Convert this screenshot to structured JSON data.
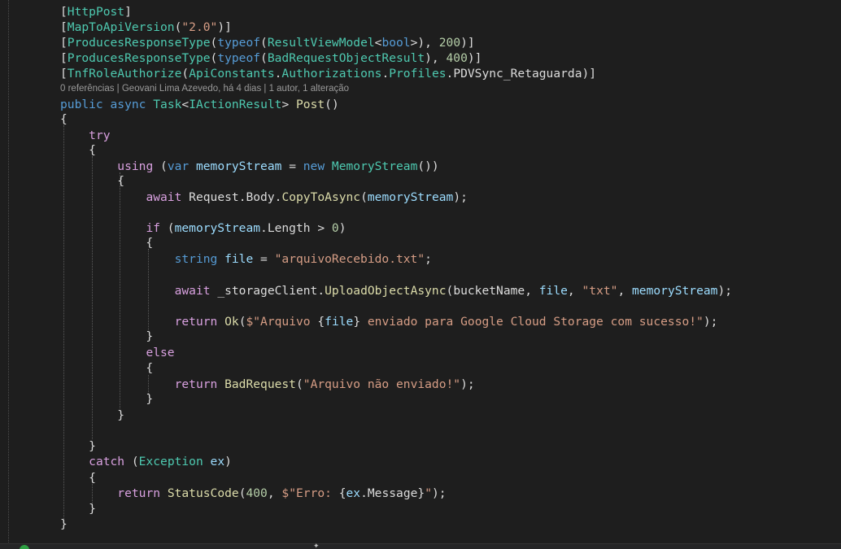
{
  "editor": {
    "codelens": "0 referências | Geovani Lima Azevedo, há 4 dias | 1 autor, 1 alteração",
    "lines": [
      [
        [
          "pn",
          "["
        ],
        [
          "ty",
          "HttpPost"
        ],
        [
          "pn",
          "]"
        ]
      ],
      [
        [
          "pn",
          "["
        ],
        [
          "ty",
          "MapToApiVersion"
        ],
        [
          "pn",
          "("
        ],
        [
          "str",
          "\"2.0\""
        ],
        [
          "pn",
          ")]"
        ]
      ],
      [
        [
          "pn",
          "["
        ],
        [
          "ty",
          "ProducesResponseType"
        ],
        [
          "pn",
          "("
        ],
        [
          "kw",
          "typeof"
        ],
        [
          "pn",
          "("
        ],
        [
          "ty",
          "ResultViewModel"
        ],
        [
          "pn",
          "<"
        ],
        [
          "kw",
          "bool"
        ],
        [
          "pn",
          ">), "
        ],
        [
          "num",
          "200"
        ],
        [
          "pn",
          ")]"
        ]
      ],
      [
        [
          "pn",
          "["
        ],
        [
          "ty",
          "ProducesResponseType"
        ],
        [
          "pn",
          "("
        ],
        [
          "kw",
          "typeof"
        ],
        [
          "pn",
          "("
        ],
        [
          "ty",
          "BadRequestObjectResult"
        ],
        [
          "pn",
          "), "
        ],
        [
          "num",
          "400"
        ],
        [
          "pn",
          ")]"
        ]
      ],
      [
        [
          "pn",
          "["
        ],
        [
          "ty",
          "TnfRoleAuthorize"
        ],
        [
          "pn",
          "("
        ],
        [
          "ty",
          "ApiConstants"
        ],
        [
          "pn",
          "."
        ],
        [
          "ty",
          "Authorizations"
        ],
        [
          "pn",
          "."
        ],
        [
          "ty",
          "Profiles"
        ],
        [
          "pn",
          "."
        ],
        [
          "ident",
          "PDVSync_Retaguarda"
        ],
        [
          "pn",
          ")]"
        ]
      ],
      [
        [
          "kw",
          "public"
        ],
        [
          "pn",
          " "
        ],
        [
          "kw",
          "async"
        ],
        [
          "pn",
          " "
        ],
        [
          "ty",
          "Task"
        ],
        [
          "pn",
          "<"
        ],
        [
          "ty",
          "IActionResult"
        ],
        [
          "pn",
          "> "
        ],
        [
          "fn",
          "Post"
        ],
        [
          "pn",
          "()"
        ]
      ],
      [
        [
          "pn",
          "{"
        ]
      ],
      [
        [
          "pn",
          "    "
        ],
        [
          "ctl",
          "try"
        ]
      ],
      [
        [
          "pn",
          "    {"
        ]
      ],
      [
        [
          "pn",
          "        "
        ],
        [
          "ctl",
          "using"
        ],
        [
          "pn",
          " ("
        ],
        [
          "kw",
          "var"
        ],
        [
          "pn",
          " "
        ],
        [
          "var",
          "memoryStream"
        ],
        [
          "pn",
          " = "
        ],
        [
          "kw",
          "new"
        ],
        [
          "pn",
          " "
        ],
        [
          "ty",
          "MemoryStream"
        ],
        [
          "pn",
          "())"
        ]
      ],
      [
        [
          "pn",
          "        {"
        ]
      ],
      [
        [
          "pn",
          "            "
        ],
        [
          "ctl",
          "await"
        ],
        [
          "pn",
          " "
        ],
        [
          "ident",
          "Request"
        ],
        [
          "pn",
          "."
        ],
        [
          "ident",
          "Body"
        ],
        [
          "pn",
          "."
        ],
        [
          "fn",
          "CopyToAsync"
        ],
        [
          "pn",
          "("
        ],
        [
          "var",
          "memoryStream"
        ],
        [
          "pn",
          ");"
        ]
      ],
      [],
      [
        [
          "pn",
          "            "
        ],
        [
          "ctl",
          "if"
        ],
        [
          "pn",
          " ("
        ],
        [
          "var",
          "memoryStream"
        ],
        [
          "pn",
          "."
        ],
        [
          "ident",
          "Length"
        ],
        [
          "pn",
          " > "
        ],
        [
          "num",
          "0"
        ],
        [
          "pn",
          ")"
        ]
      ],
      [
        [
          "pn",
          "            {"
        ]
      ],
      [
        [
          "pn",
          "                "
        ],
        [
          "kw",
          "string"
        ],
        [
          "pn",
          " "
        ],
        [
          "var",
          "file"
        ],
        [
          "pn",
          " = "
        ],
        [
          "str",
          "\"arquivoRecebido.txt\""
        ],
        [
          "pn",
          ";"
        ]
      ],
      [],
      [
        [
          "pn",
          "                "
        ],
        [
          "ctl",
          "await"
        ],
        [
          "pn",
          " "
        ],
        [
          "ident",
          "_storageClient"
        ],
        [
          "pn",
          "."
        ],
        [
          "fn",
          "UploadObjectAsync"
        ],
        [
          "pn",
          "("
        ],
        [
          "ident",
          "bucketName"
        ],
        [
          "pn",
          ", "
        ],
        [
          "var",
          "file"
        ],
        [
          "pn",
          ", "
        ],
        [
          "str",
          "\"txt\""
        ],
        [
          "pn",
          ", "
        ],
        [
          "var",
          "memoryStream"
        ],
        [
          "pn",
          ");"
        ]
      ],
      [],
      [
        [
          "pn",
          "                "
        ],
        [
          "ctl",
          "return"
        ],
        [
          "pn",
          " "
        ],
        [
          "fn",
          "Ok"
        ],
        [
          "pn",
          "("
        ],
        [
          "str",
          "$\"Arquivo "
        ],
        [
          "interp",
          "{"
        ],
        [
          "var",
          "file"
        ],
        [
          "interp",
          "}"
        ],
        [
          "str",
          " enviado para Google Cloud Storage com sucesso!\""
        ],
        [
          "pn",
          ");"
        ]
      ],
      [
        [
          "pn",
          "            }"
        ]
      ],
      [
        [
          "pn",
          "            "
        ],
        [
          "ctl",
          "else"
        ]
      ],
      [
        [
          "pn",
          "            {"
        ]
      ],
      [
        [
          "pn",
          "                "
        ],
        [
          "ctl",
          "return"
        ],
        [
          "pn",
          " "
        ],
        [
          "fn",
          "BadRequest"
        ],
        [
          "pn",
          "("
        ],
        [
          "str",
          "\"Arquivo não enviado!\""
        ],
        [
          "pn",
          ");"
        ]
      ],
      [
        [
          "pn",
          "            }"
        ]
      ],
      [
        [
          "pn",
          "        }"
        ]
      ],
      [],
      [
        [
          "pn",
          "    }"
        ]
      ],
      [
        [
          "pn",
          "    "
        ],
        [
          "ctl",
          "catch"
        ],
        [
          "pn",
          " ("
        ],
        [
          "ty",
          "Exception"
        ],
        [
          "pn",
          " "
        ],
        [
          "var",
          "ex"
        ],
        [
          "pn",
          ")"
        ]
      ],
      [
        [
          "pn",
          "    {"
        ]
      ],
      [
        [
          "pn",
          "        "
        ],
        [
          "ctl",
          "return"
        ],
        [
          "pn",
          " "
        ],
        [
          "fn",
          "StatusCode"
        ],
        [
          "pn",
          "("
        ],
        [
          "num",
          "400"
        ],
        [
          "pn",
          ", "
        ],
        [
          "str",
          "$\"Erro: "
        ],
        [
          "interp",
          "{"
        ],
        [
          "var",
          "ex"
        ],
        [
          "pn",
          "."
        ],
        [
          "ident",
          "Message"
        ],
        [
          "interp",
          "}"
        ],
        [
          "str",
          "\""
        ],
        [
          "pn",
          ");"
        ]
      ],
      [
        [
          "pn",
          "    }"
        ]
      ],
      [
        [
          "pn",
          "}"
        ]
      ]
    ]
  }
}
